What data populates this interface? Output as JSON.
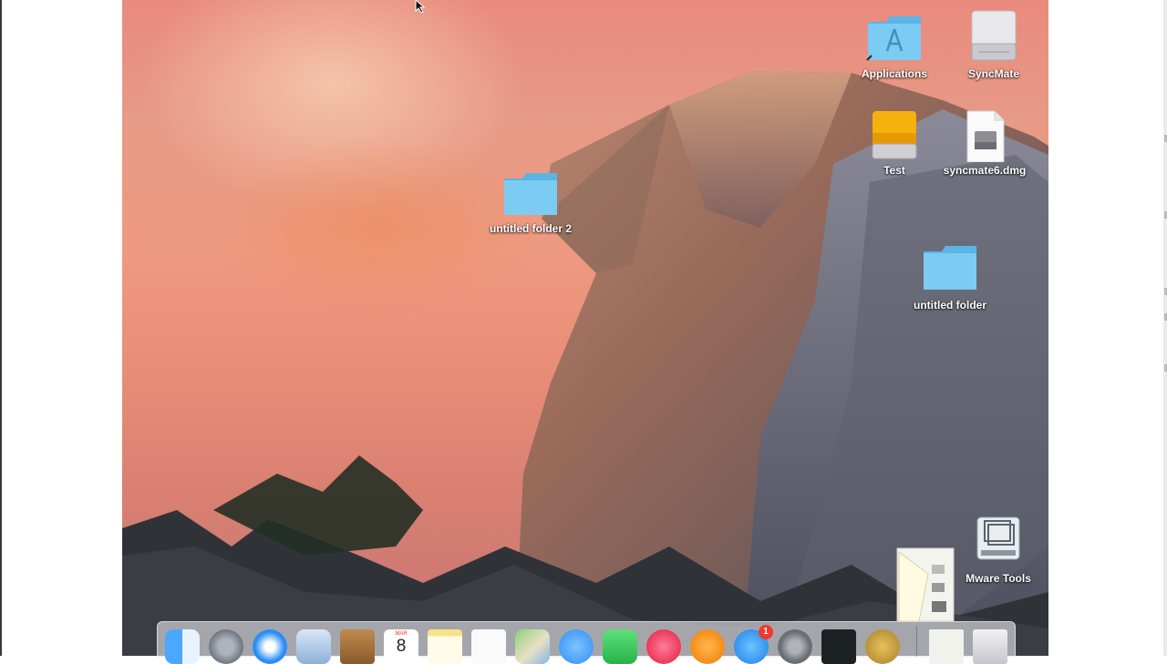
{
  "desktop": {
    "icons": [
      {
        "label": "Applications",
        "icon": "applications-folder-icon"
      },
      {
        "label": "SyncMate",
        "icon": "disk-drive-icon"
      },
      {
        "label": "Test",
        "icon": "external-drive-icon"
      },
      {
        "label": "syncmate6.dmg",
        "icon": "dmg-file-icon"
      },
      {
        "label": "untitled folder 2",
        "icon": "folder-icon"
      },
      {
        "label": "untitled folder",
        "icon": "folder-icon"
      },
      {
        "label": "Mware Tools",
        "icon": "vmware-tools-icon"
      }
    ]
  },
  "dock": {
    "apps": [
      "finder-icon",
      "launchpad-icon",
      "safari-icon",
      "mail-icon",
      "contacts-icon",
      "calendar-icon",
      "notes-icon",
      "reminders-icon",
      "maps-icon",
      "messages-icon",
      "facetime-icon",
      "itunes-icon",
      "ibooks-icon",
      "app-store-icon",
      "system-preferences-icon",
      "activity-monitor-icon",
      "keychain-icon",
      "documents-stack-icon",
      "trash-icon"
    ],
    "calendar_month": "MAR",
    "calendar_day": "8",
    "app_store_badge": "1"
  },
  "colors": {
    "folder_blue": "#6cc4f0",
    "dock_bg": "#e6e6eb",
    "badge_red": "#f2372d"
  }
}
